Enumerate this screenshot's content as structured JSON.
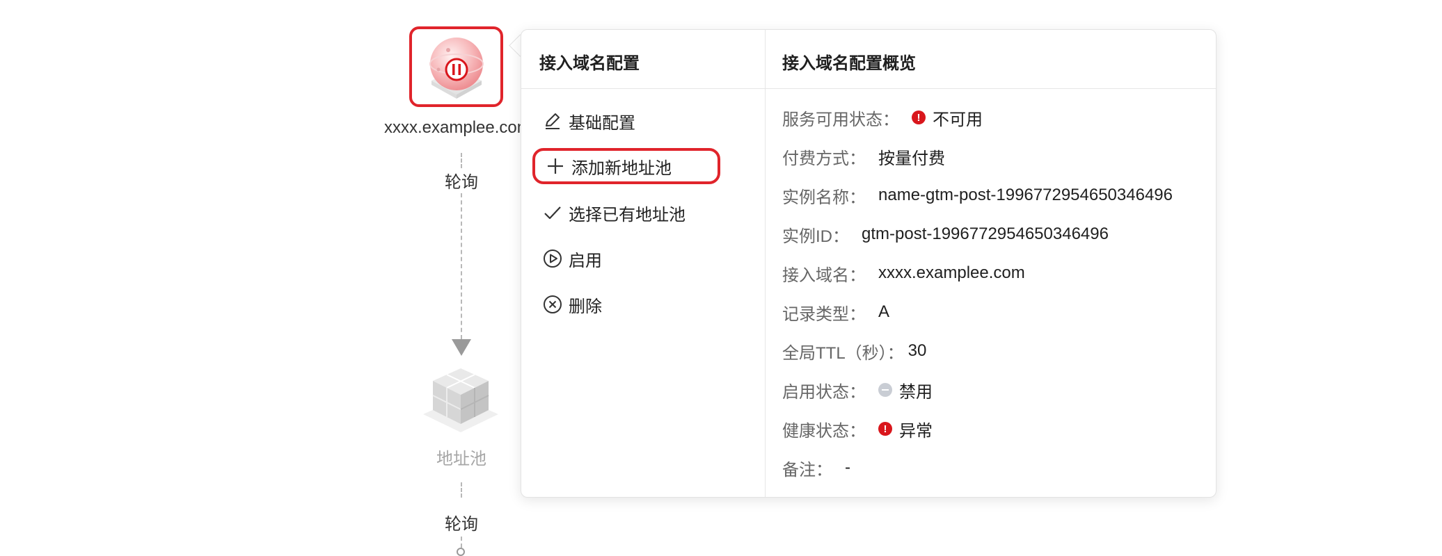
{
  "topology": {
    "domain_label": "xxxx.examplee.com",
    "poll_label_1": "轮询",
    "pool_label": "地址池",
    "poll_label_2": "轮询",
    "icons": {
      "domain": "paused-domain-globe-icon",
      "pool": "address-pool-cube-icon"
    }
  },
  "menu": {
    "title": "接入域名配置",
    "items": [
      {
        "label": "基础配置",
        "icon": "edit-icon"
      },
      {
        "label": "添加新地址池",
        "icon": "plus-icon"
      },
      {
        "label": "选择已有地址池",
        "icon": "check-icon"
      },
      {
        "label": "启用",
        "icon": "play-circle-icon"
      },
      {
        "label": "删除",
        "icon": "close-circle-icon"
      }
    ]
  },
  "overview": {
    "title": "接入域名配置概览",
    "rows": [
      {
        "key": "服务可用状态：",
        "value": "不可用",
        "status": "error"
      },
      {
        "key": "付费方式：",
        "value": "按量付费"
      },
      {
        "key": "实例名称：",
        "value": "name-gtm-post-1996772954650346496"
      },
      {
        "key": "实例ID：",
        "value": "gtm-post-1996772954650346496"
      },
      {
        "key": "接入域名：",
        "value": "xxxx.examplee.com"
      },
      {
        "key": "记录类型：",
        "value": "A"
      },
      {
        "key": "全局TTL（秒）：",
        "value": "30"
      },
      {
        "key": "启用状态：",
        "value": "禁用",
        "status": "disabled"
      },
      {
        "key": "健康状态：",
        "value": "异常",
        "status": "error"
      },
      {
        "key": "备注：",
        "value": "-"
      }
    ]
  },
  "colors": {
    "accent_red": "#e0242b",
    "error_red": "#d9161c",
    "disabled_gray": "#c9cdd4"
  }
}
